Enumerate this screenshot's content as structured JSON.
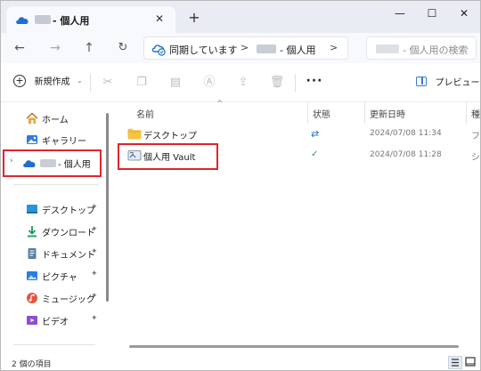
{
  "titlebar": {
    "tab_title": "- 個人用",
    "tab_close": "✕",
    "add_tab": "+",
    "minimize": "—",
    "maximize": "☐",
    "close": "✕"
  },
  "address": {
    "sync_status": "同期しています",
    "separator": ">",
    "crumb": "- 個人用",
    "search_placeholder": "- 個人用の検索"
  },
  "nav": {
    "back": "←",
    "forward": "→",
    "up": "↑",
    "refresh": "↻"
  },
  "toolbar": {
    "new_label": "新規作成",
    "new_plus": "+",
    "new_caret": "⌄",
    "more": "···",
    "preview_label": "プレビュー",
    "icons": [
      "cut-icon",
      "copy-icon",
      "paste-icon",
      "rename-icon",
      "share-icon",
      "delete-icon"
    ]
  },
  "sidebar": {
    "items": [
      {
        "label": "ホーム",
        "icon": "home-icon"
      },
      {
        "label": "ギャラリー",
        "icon": "gallery-icon"
      },
      {
        "label": "- 個人用",
        "icon": "onedrive-icon",
        "expand": "›"
      }
    ],
    "quick": [
      {
        "label": "デスクトップ",
        "icon": "desktop-icon",
        "pin": "📌"
      },
      {
        "label": "ダウンロード",
        "icon": "download-icon",
        "pin": "📌"
      },
      {
        "label": "ドキュメント",
        "icon": "documents-icon",
        "pin": "📌"
      },
      {
        "label": "ピクチャ",
        "icon": "pictures-icon",
        "pin": "📌"
      },
      {
        "label": "ミュージック",
        "icon": "music-icon",
        "pin": "📌"
      },
      {
        "label": "ビデオ",
        "icon": "videos-icon",
        "pin": "📌"
      }
    ]
  },
  "columns": {
    "name": "名前",
    "status": "状態",
    "modified": "更新日時",
    "type": "種",
    "sort_indicator": "^"
  },
  "files": [
    {
      "name": "デスクトップ",
      "icon": "folder-icon",
      "status_icon": "sync-icon",
      "status_glyph": "⇄",
      "modified": "2024/07/08 11:34",
      "type": "フ"
    },
    {
      "name": "個人用 Vault",
      "icon": "vault-icon",
      "status_icon": "available-icon",
      "status_glyph": "✓",
      "modified": "2024/07/08 11:28",
      "type": "シ"
    }
  ],
  "status": {
    "item_count": "2 個の項目"
  },
  "colors": {
    "highlight": "#e0242e",
    "accent": "#0f6cbd",
    "folder": "#f5c344"
  }
}
